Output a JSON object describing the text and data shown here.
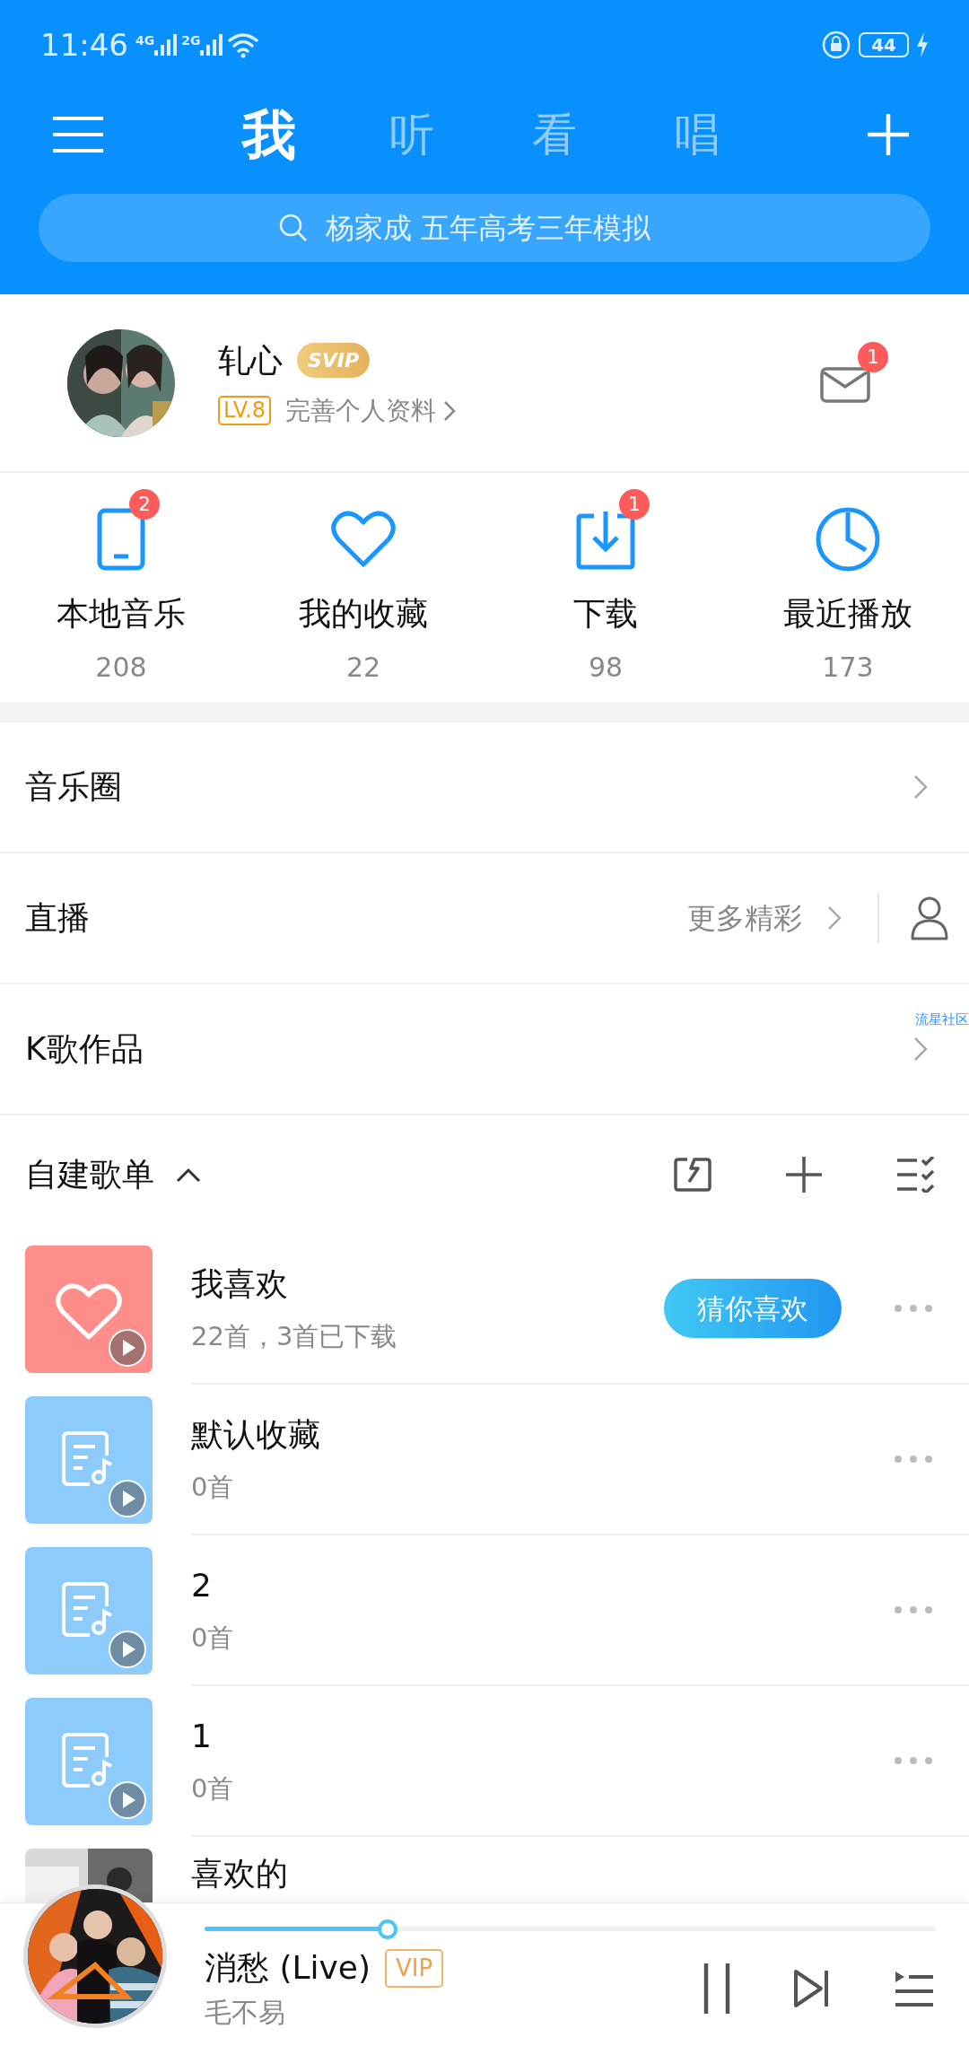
{
  "status_bar": {
    "time": "11:46",
    "signals": [
      "4G",
      "2G"
    ],
    "battery": "44"
  },
  "top_tabs": [
    {
      "label": "我",
      "selected": true
    },
    {
      "label": "听",
      "selected": false
    },
    {
      "label": "看",
      "selected": false
    },
    {
      "label": "唱",
      "selected": false
    }
  ],
  "search": {
    "placeholder": "杨家成 五年高考三年模拟"
  },
  "profile": {
    "name": "轧心",
    "badge": "SVIP",
    "level": "LV.8",
    "edit_link": "完善个人资料",
    "mail_count": "1"
  },
  "shortcuts": [
    {
      "kind": "phone",
      "label": "本地音乐",
      "count": "208",
      "badge": "2"
    },
    {
      "kind": "heart",
      "label": "我的收藏",
      "count": "22"
    },
    {
      "kind": "download",
      "label": "下载",
      "count": "98",
      "badge": "1"
    },
    {
      "kind": "clock",
      "label": "最近播放",
      "count": "173"
    }
  ],
  "menu_rows": [
    {
      "kind": "plain",
      "label": "音乐圈"
    },
    {
      "kind": "live",
      "label": "直播",
      "extra": "更多精彩"
    },
    {
      "kind": "tagged",
      "label": "K歌作品",
      "tag": "流星社区"
    }
  ],
  "playlists_header": {
    "title": "自建歌单",
    "expanded": true
  },
  "playlists": [
    {
      "kind": "favorite",
      "title": "我喜欢",
      "subtitle": "22首，3首已下载",
      "button": "猜你喜欢"
    },
    {
      "kind": "list",
      "title": "默认收藏",
      "subtitle": "0首"
    },
    {
      "kind": "list",
      "title": "2",
      "subtitle": "0首"
    },
    {
      "kind": "list",
      "title": "1",
      "subtitle": "0首"
    },
    {
      "kind": "picture",
      "title": "喜欢的"
    }
  ],
  "player": {
    "title": "消愁 (Live)",
    "badge": "VIP",
    "artist": "毛不易",
    "level": 0.25,
    "playing": true
  }
}
